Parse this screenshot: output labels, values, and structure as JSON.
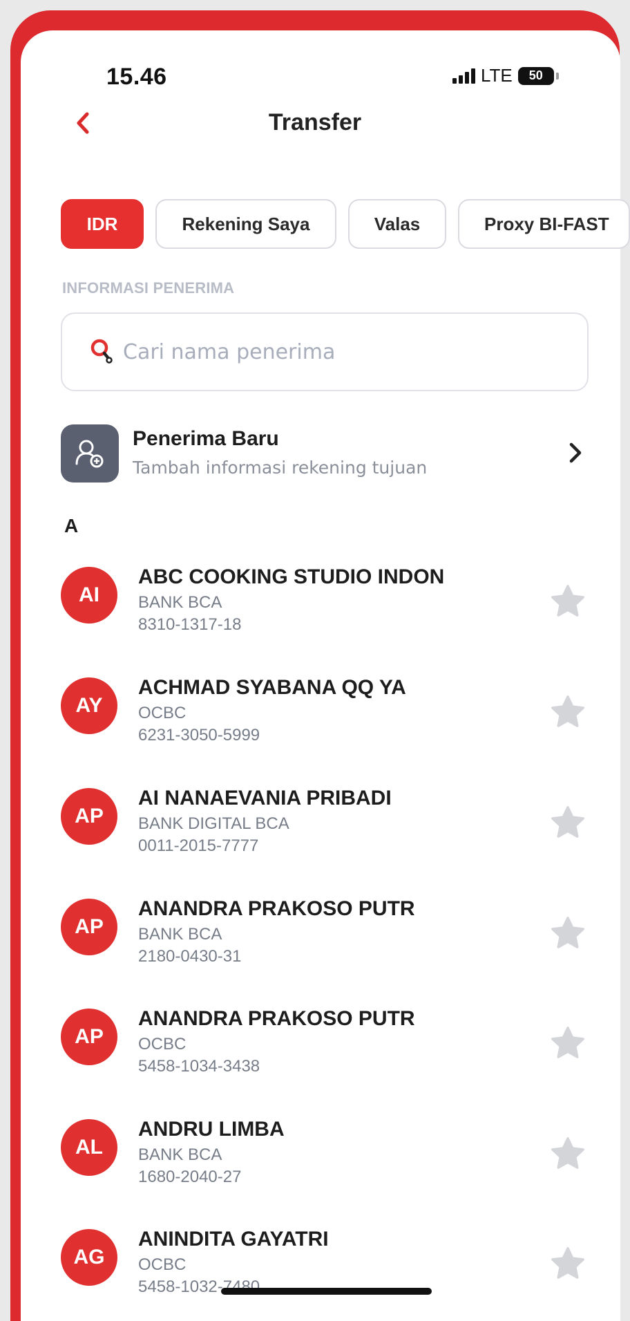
{
  "status_bar": {
    "time": "15.46",
    "network": "LTE",
    "battery": "50"
  },
  "header": {
    "title": "Transfer"
  },
  "tabs": [
    {
      "label": "IDR",
      "active": true
    },
    {
      "label": "Rekening Saya",
      "active": false
    },
    {
      "label": "Valas",
      "active": false
    },
    {
      "label": "Proxy BI-FAST",
      "active": false
    }
  ],
  "section_label": "INFORMASI PENERIMA",
  "search": {
    "placeholder": "Cari nama penerima",
    "value": ""
  },
  "new_recipient": {
    "title": "Penerima Baru",
    "subtitle": "Tambah informasi rekening tujuan"
  },
  "group_letter": "A",
  "contacts": [
    {
      "initials": "AI",
      "name": "ABC COOKING STUDIO INDON",
      "bank": "BANK BCA",
      "account": "8310-1317-18"
    },
    {
      "initials": "AY",
      "name": "ACHMAD SYABANA QQ YA",
      "bank": "OCBC",
      "account": "6231-3050-5999"
    },
    {
      "initials": "AP",
      "name": "AI NANAEVANIA PRIBADI",
      "bank": "BANK DIGITAL BCA",
      "account": "0011-2015-7777"
    },
    {
      "initials": "AP",
      "name": "ANANDRA PRAKOSO PUTR",
      "bank": "BANK BCA",
      "account": "2180-0430-31"
    },
    {
      "initials": "AP",
      "name": "ANANDRA PRAKOSO PUTR",
      "bank": "OCBC",
      "account": "5458-1034-3438"
    },
    {
      "initials": "AL",
      "name": "ANDRU LIMBA",
      "bank": "BANK BCA",
      "account": "1680-2040-27"
    },
    {
      "initials": "AG",
      "name": "ANINDITA GAYATRI",
      "bank": "OCBC",
      "account": "5458-1032-7480"
    }
  ],
  "colors": {
    "brand_red": "#e0302f",
    "frame_red": "#dc2a2f",
    "muted_text": "#777d88",
    "star_gray": "#d3d5d9"
  }
}
